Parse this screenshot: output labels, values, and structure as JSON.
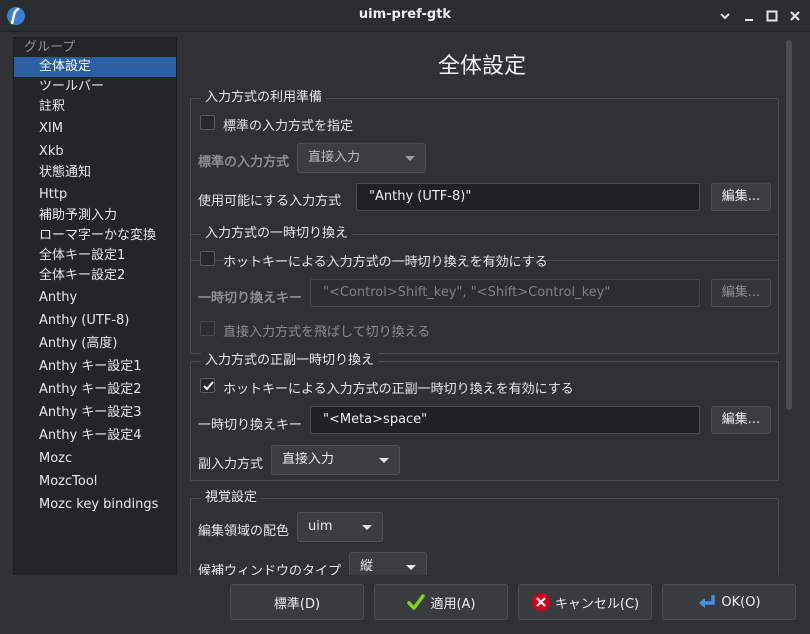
{
  "window": {
    "title": "uim-pref-gtk"
  },
  "sidebar": {
    "header": "グループ",
    "items": [
      {
        "label": "全体設定"
      },
      {
        "label": "ツールバー"
      },
      {
        "label": "註釈"
      },
      {
        "label": "XIM"
      },
      {
        "label": "Xkb"
      },
      {
        "label": "状態通知"
      },
      {
        "label": "Http"
      },
      {
        "label": "補助予測入力"
      },
      {
        "label": "ローマ字ーかな変換"
      },
      {
        "label": "全体キー設定1"
      },
      {
        "label": "全体キー設定2"
      },
      {
        "label": "Anthy"
      },
      {
        "label": "Anthy (UTF-8)"
      },
      {
        "label": "Anthy (高度)"
      },
      {
        "label": "Anthy キー設定1"
      },
      {
        "label": "Anthy キー設定2"
      },
      {
        "label": "Anthy キー設定3"
      },
      {
        "label": "Anthy キー設定4"
      },
      {
        "label": "Mozc"
      },
      {
        "label": "MozcTool"
      },
      {
        "label": "Mozc key bindings"
      }
    ],
    "selected": "全体設定"
  },
  "main": {
    "page_title": "全体設定",
    "section1": {
      "label": "入力方式の利用準備",
      "checkbox_label": "標準の入力方式を指定",
      "checkbox_checked": false,
      "default_im_label": "標準の入力方式",
      "default_im_value": "直接入力",
      "enabled_im_label": "使用可能にする入力方式",
      "enabled_im_value": "\"Anthy (UTF-8)\"",
      "edit_button": "編集..."
    },
    "section2": {
      "label": "入力方式の一時切り換え",
      "checkbox_label": "ホットキーによる入力方式の一時切り換えを有効にする",
      "checkbox_checked": false,
      "hotkey_label": "一時切り換えキー",
      "hotkey_value": "\"<Control>Shift_key\", \"<Shift>Control_key\"",
      "edit_button": "編集...",
      "skip_label": "直接入力方式を飛ばして切り換える",
      "skip_checked": false
    },
    "section3": {
      "label": "入力方式の正副一時切り換え",
      "checkbox_label": "ホットキーによる入力方式の正副一時切り換えを有効にする",
      "checkbox_checked": true,
      "hotkey_label": "一時切り換えキー",
      "hotkey_value": "\"<Meta>space\"",
      "edit_button": "編集...",
      "secondary_label": "副入力方式",
      "secondary_value": "直接入力"
    },
    "section4": {
      "label": "視覚設定",
      "color_label": "編集領域の配色",
      "color_value": "uim",
      "candidate_label": "候補ウィンドウのタイプ",
      "candidate_value": "縦"
    }
  },
  "buttons": {
    "defaults": "標準(D)",
    "apply": "適用(A)",
    "cancel": "キャンセル(C)",
    "ok": "OK(O)"
  },
  "colors": {
    "selection": "#2a5fa2",
    "background": "#2f3234",
    "apply_icon": "#7ed321",
    "cancel_icon": "#d0021b",
    "ok_icon": "#4a90e2"
  }
}
